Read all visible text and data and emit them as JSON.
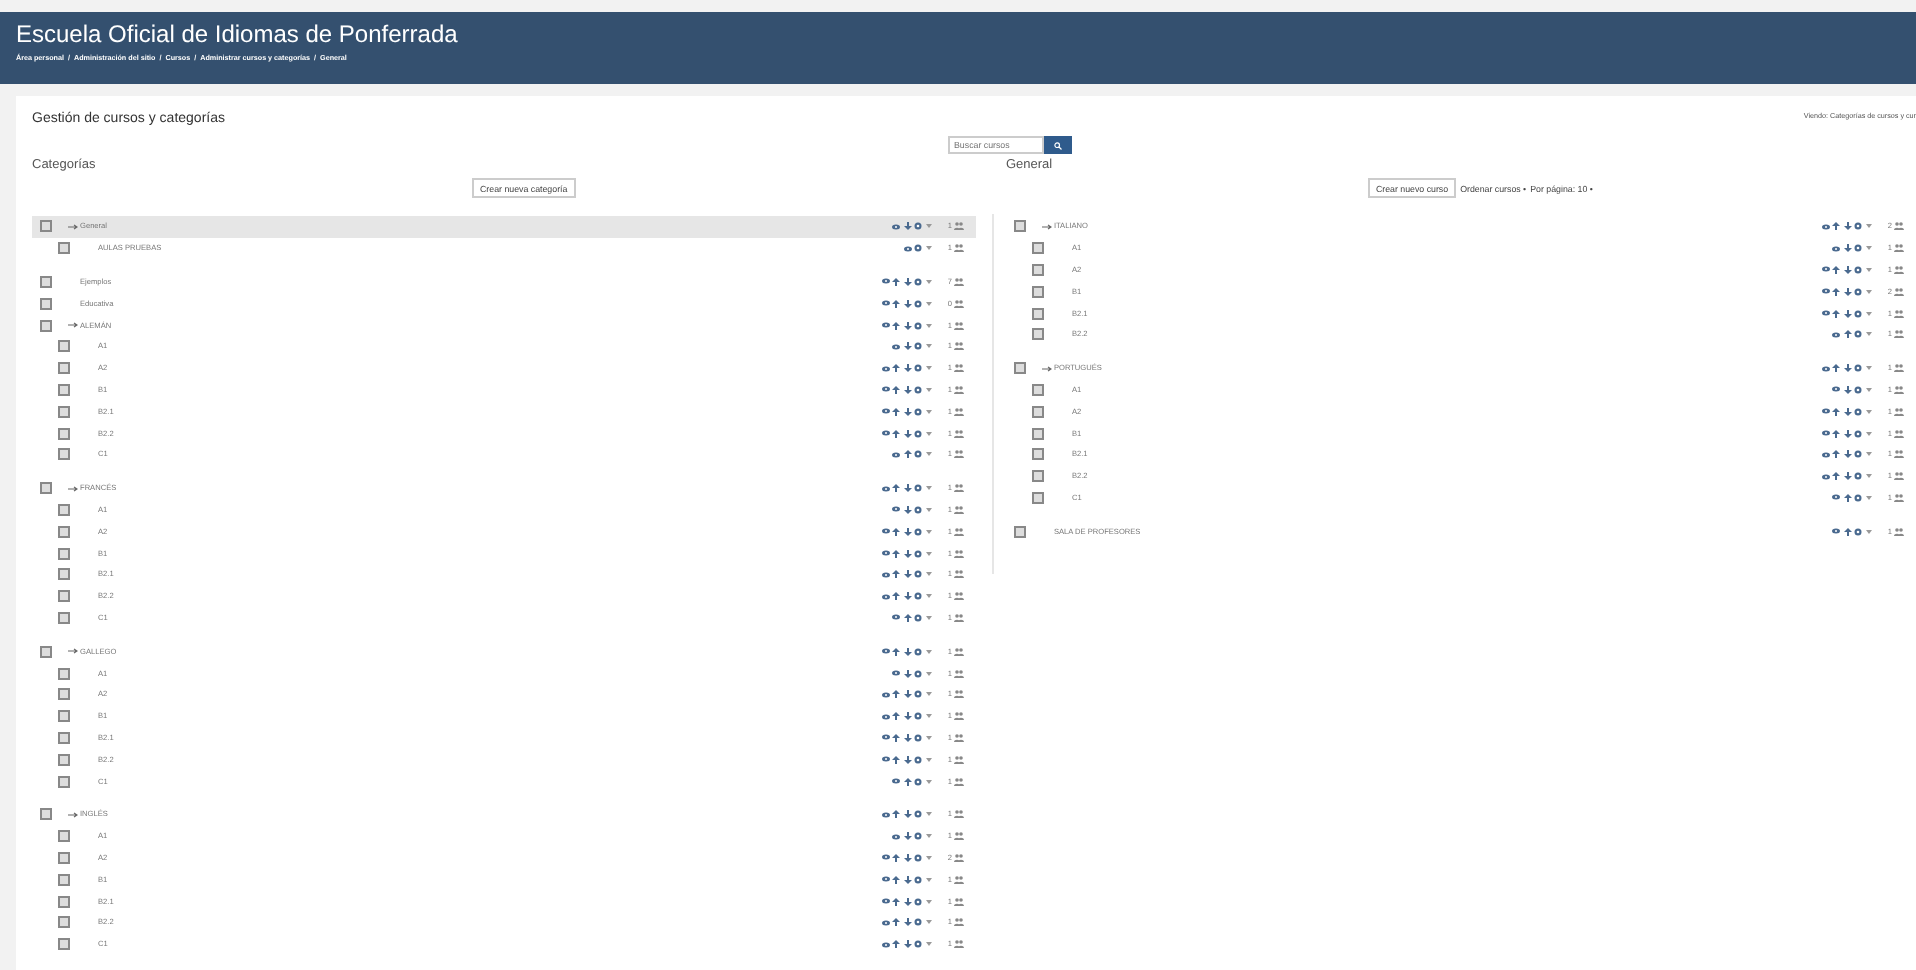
{
  "header": {
    "title": "Escuela Oficial de Idiomas de Ponferrada",
    "breadcrumb": [
      "Área personal",
      "Administración del sitio",
      "Cursos",
      "Administrar cursos y categorías",
      "General"
    ],
    "separator": "/"
  },
  "page_title": "Gestión de cursos y categorías",
  "viewing": "Viendo: Categorías de cursos y cur",
  "search": {
    "placeholder": "Buscar cursos"
  },
  "categories": {
    "heading": "Categorías",
    "button": "Crear nueva categoría",
    "items": [
      {
        "name": "General",
        "checked": false,
        "selected": true,
        "expanded": true,
        "move_up": false,
        "move_down": true,
        "count": "1",
        "children": [
          {
            "name": "AULAS PRUEBAS",
            "checked": false,
            "selected": false,
            "move_up": false,
            "move_down": false,
            "count": "1"
          }
        ]
      },
      {
        "name": "Ejemplos",
        "checked": false,
        "selected": false,
        "move_up": true,
        "move_down": true,
        "count": "7"
      },
      {
        "name": "Educativa",
        "checked": false,
        "selected": false,
        "move_up": true,
        "move_down": true,
        "count": "0"
      },
      {
        "name": "ALEMÁN",
        "checked": false,
        "selected": false,
        "expanded": true,
        "move_up": true,
        "move_down": true,
        "count": "1",
        "children": [
          {
            "name": "A1",
            "checked": false,
            "selected": false,
            "move_up": false,
            "move_down": true,
            "count": "1"
          },
          {
            "name": "A2",
            "checked": false,
            "selected": false,
            "move_up": true,
            "move_down": true,
            "count": "1"
          },
          {
            "name": "B1",
            "checked": false,
            "selected": false,
            "move_up": true,
            "move_down": true,
            "count": "1"
          },
          {
            "name": "B2.1",
            "checked": false,
            "selected": false,
            "move_up": true,
            "move_down": true,
            "count": "1"
          },
          {
            "name": "B2.2",
            "checked": false,
            "selected": false,
            "move_up": true,
            "move_down": true,
            "count": "1"
          },
          {
            "name": "C1",
            "checked": false,
            "selected": false,
            "move_up": true,
            "move_down": false,
            "count": "1"
          }
        ]
      },
      {
        "name": "FRANCÉS",
        "checked": false,
        "selected": false,
        "expanded": true,
        "move_up": true,
        "move_down": true,
        "count": "1",
        "children": [
          {
            "name": "A1",
            "checked": false,
            "selected": false,
            "move_up": false,
            "move_down": true,
            "count": "1"
          },
          {
            "name": "A2",
            "checked": false,
            "selected": false,
            "move_up": true,
            "move_down": true,
            "count": "1"
          },
          {
            "name": "B1",
            "checked": false,
            "selected": false,
            "move_up": true,
            "move_down": true,
            "count": "1"
          },
          {
            "name": "B2.1",
            "checked": false,
            "selected": false,
            "move_up": true,
            "move_down": true,
            "count": "1"
          },
          {
            "name": "B2.2",
            "checked": false,
            "selected": false,
            "move_up": true,
            "move_down": true,
            "count": "1"
          },
          {
            "name": "C1",
            "checked": false,
            "selected": false,
            "move_up": true,
            "move_down": false,
            "count": "1"
          }
        ]
      },
      {
        "name": "GALLEGO",
        "checked": false,
        "selected": false,
        "expanded": true,
        "move_up": true,
        "move_down": true,
        "count": "1",
        "children": [
          {
            "name": "A1",
            "checked": false,
            "selected": false,
            "move_up": false,
            "move_down": true,
            "count": "1"
          },
          {
            "name": "A2",
            "checked": false,
            "selected": false,
            "move_up": true,
            "move_down": true,
            "count": "1"
          },
          {
            "name": "B1",
            "checked": false,
            "selected": false,
            "move_up": true,
            "move_down": true,
            "count": "1"
          },
          {
            "name": "B2.1",
            "checked": false,
            "selected": false,
            "move_up": true,
            "move_down": true,
            "count": "1"
          },
          {
            "name": "B2.2",
            "checked": false,
            "selected": false,
            "move_up": true,
            "move_down": true,
            "count": "1"
          },
          {
            "name": "C1",
            "checked": false,
            "selected": false,
            "move_up": true,
            "move_down": false,
            "count": "1"
          }
        ]
      },
      {
        "name": "INGLÉS",
        "checked": false,
        "selected": false,
        "expanded": true,
        "move_up": true,
        "move_down": true,
        "count": "1",
        "children": [
          {
            "name": "A1",
            "checked": false,
            "selected": false,
            "move_up": false,
            "move_down": true,
            "count": "1"
          },
          {
            "name": "A2",
            "checked": false,
            "selected": false,
            "move_up": true,
            "move_down": true,
            "count": "2"
          },
          {
            "name": "B1",
            "checked": false,
            "selected": false,
            "move_up": true,
            "move_down": true,
            "count": "1"
          },
          {
            "name": "B2.1",
            "checked": false,
            "selected": false,
            "move_up": true,
            "move_down": true,
            "count": "1"
          },
          {
            "name": "B2.2",
            "checked": false,
            "selected": false,
            "move_up": true,
            "move_down": true,
            "count": "1"
          },
          {
            "name": "C1",
            "checked": false,
            "selected": false,
            "move_up": true,
            "move_down": true,
            "count": "1"
          }
        ]
      }
    ]
  },
  "courses": {
    "heading": "General",
    "button": "Crear nuevo curso",
    "sort": "Ordenar cursos •",
    "per_page": "Por página: 10 •",
    "items": [
      {
        "name": "ITALIANO",
        "checked": false,
        "selected": false,
        "expanded": true,
        "move_up": true,
        "move_down": true,
        "count": "2",
        "children": [
          {
            "name": "A1",
            "checked": false,
            "selected": false,
            "move_up": false,
            "move_down": true,
            "count": "1"
          },
          {
            "name": "A2",
            "checked": false,
            "selected": false,
            "move_up": true,
            "move_down": true,
            "count": "1"
          },
          {
            "name": "B1",
            "checked": false,
            "selected": false,
            "move_up": true,
            "move_down": true,
            "count": "2"
          },
          {
            "name": "B2.1",
            "checked": false,
            "selected": false,
            "move_up": true,
            "move_down": true,
            "count": "1"
          },
          {
            "name": "B2.2",
            "checked": false,
            "selected": false,
            "move_up": true,
            "move_down": false,
            "count": "1"
          }
        ]
      },
      {
        "name": "PORTUGUÉS",
        "checked": false,
        "selected": false,
        "expanded": true,
        "move_up": true,
        "move_down": true,
        "count": "1",
        "children": [
          {
            "name": "A1",
            "checked": false,
            "selected": false,
            "move_up": false,
            "move_down": true,
            "count": "1"
          },
          {
            "name": "A2",
            "checked": false,
            "selected": false,
            "move_up": true,
            "move_down": true,
            "count": "1"
          },
          {
            "name": "B1",
            "checked": false,
            "selected": false,
            "move_up": true,
            "move_down": true,
            "count": "1"
          },
          {
            "name": "B2.1",
            "checked": false,
            "selected": false,
            "move_up": true,
            "move_down": true,
            "count": "1"
          },
          {
            "name": "B2.2",
            "checked": false,
            "selected": false,
            "move_up": true,
            "move_down": true,
            "count": "1"
          },
          {
            "name": "C1",
            "checked": false,
            "selected": false,
            "move_up": true,
            "move_down": false,
            "count": "1"
          }
        ]
      },
      {
        "name": "SALA DE PROFESORES",
        "checked": false,
        "selected": false,
        "move_up": true,
        "move_down": false,
        "count": "1"
      }
    ]
  }
}
